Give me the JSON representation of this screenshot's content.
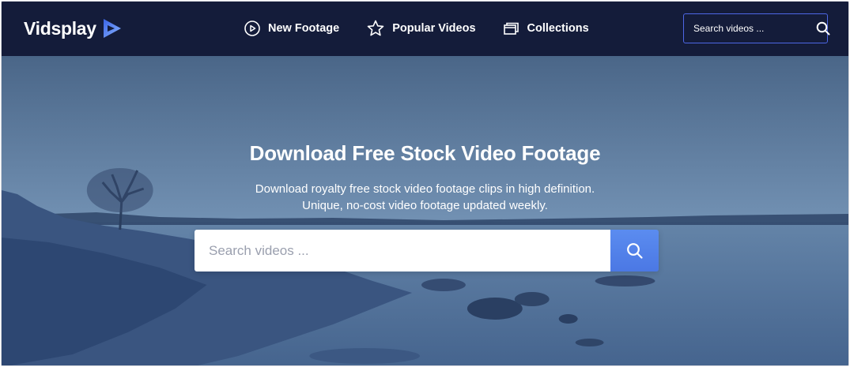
{
  "brand": {
    "name": "Vidsplay"
  },
  "nav": [
    {
      "label": "New Footage",
      "icon": "play-circle-icon"
    },
    {
      "label": "Popular Videos",
      "icon": "star-icon"
    },
    {
      "label": "Collections",
      "icon": "collections-icon"
    }
  ],
  "header_search": {
    "placeholder": "Search videos ...",
    "icon": "search-icon"
  },
  "hero": {
    "title": "Download Free Stock Video Footage",
    "subtitle_line1": "Download royalty free stock video footage clips in high definition.",
    "subtitle_line2": "Unique, no-cost video footage updated weekly.",
    "search_placeholder": "Search videos ...",
    "search_icon": "search-icon"
  },
  "colors": {
    "header_bg": "#141c3a",
    "accent": "#4d67e6",
    "search_button": "#5b8cf0"
  }
}
